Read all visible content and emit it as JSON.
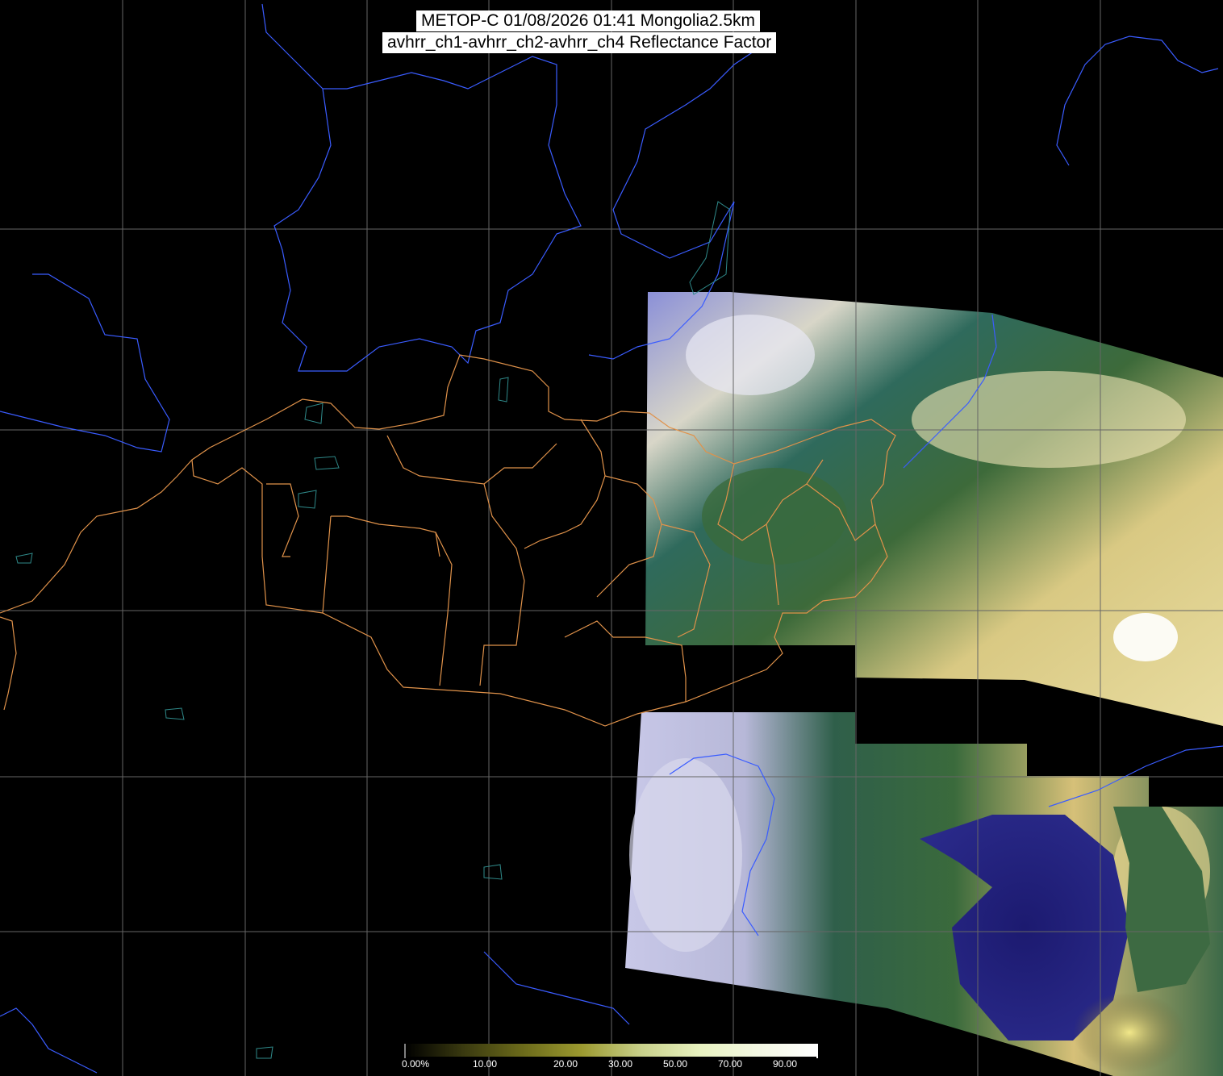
{
  "title": {
    "line1": "METOP-C 01/08/2026 01:41 Mongolia2.5km",
    "line2": "avhrr_ch1-avhrr_ch2-avhrr_ch4 Reflectance Factor"
  },
  "colorbar": {
    "labels": [
      "0.00%",
      "10.00",
      "20.00",
      "30.00",
      "50.00",
      "70.00",
      "90.00"
    ],
    "stops": [
      "#000000",
      "#3a3a10",
      "#6b6a1a",
      "#9c9a30",
      "#c8d08a",
      "#e8f2c0",
      "#f4f8e4",
      "#ffffff"
    ]
  },
  "colors": {
    "background": "#000000",
    "graticule": "#666666",
    "coastline": "#3a5cff",
    "lakes": "#2f8a8a",
    "admin_borders": "#e0924a"
  }
}
